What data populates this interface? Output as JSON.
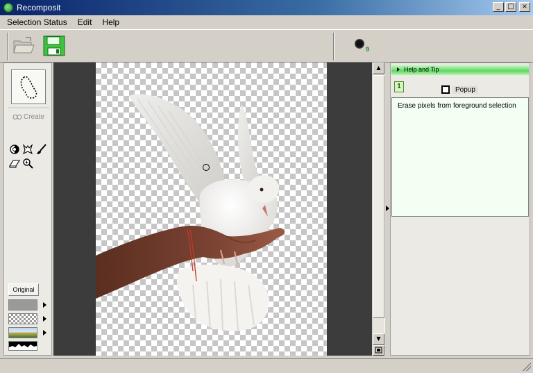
{
  "window": {
    "title": "Recomposit",
    "app_icon": "recomposit-icon",
    "controls": {
      "minimize": "_",
      "maximize": "□",
      "close": "×"
    }
  },
  "menu": {
    "items": [
      {
        "label": "Selection Status",
        "underline": "S"
      },
      {
        "label": "Edit",
        "underline": "E"
      },
      {
        "label": "Help",
        "underline": "H"
      }
    ]
  },
  "toolbar": {
    "open_icon": "open-folder-icon",
    "save_icon": "save-disk-icon",
    "brush_size": "9"
  },
  "left_panel": {
    "create_label": "Create",
    "tools": [
      "foreground-tool-icon",
      "background-tool-icon",
      "brush-icon",
      "eraser-icon",
      "zoom-icon"
    ],
    "original_label": "Original",
    "backgrounds": [
      "gray-background",
      "checker-background",
      "scenery-background",
      "mask-background"
    ]
  },
  "right_panel": {
    "header": "Help and Tip",
    "step": "1",
    "popup_label": "Popup",
    "popup_checked": false,
    "help_text": "Erase pixels from foreground selection"
  },
  "scrollbar": {
    "up": "▲",
    "down": "▼"
  },
  "colors": {
    "title_gradient_start": "#0a246a",
    "help_header": "#5fd85f",
    "help_bg": "#f4fff4",
    "canvas_bg": "#3c3c3c"
  }
}
